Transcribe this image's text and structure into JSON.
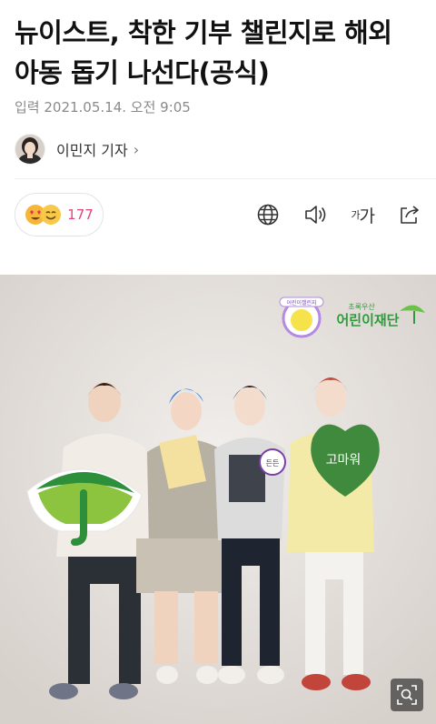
{
  "article": {
    "headline": "뉴이스트, 착한 기부 챌린지로 해외 아동 돕기 나선다(공식)",
    "published": "입력 2021.05.14. 오전 9:05",
    "author": "이민지 기자"
  },
  "reactions": {
    "count": "177"
  },
  "toolbar": {
    "font_label": "가"
  },
  "photo": {
    "charity_logo_text": "어린이재단",
    "charity_tagline": "초록우산",
    "challenge_badge_text": "어린이챌린지",
    "heart_sign_text": "고마워",
    "card_text": "든든"
  }
}
